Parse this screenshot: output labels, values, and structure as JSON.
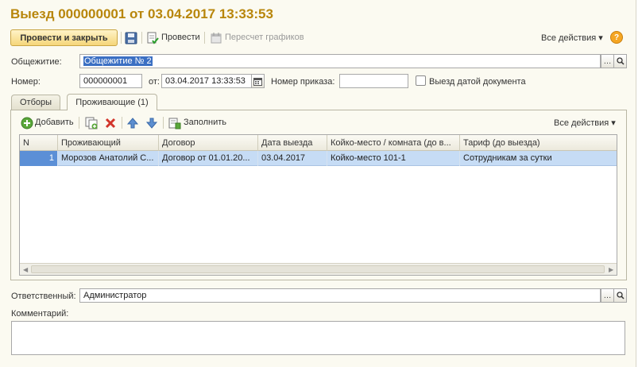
{
  "window": {
    "title": "Выезд 000000001 от 03.04.2017 13:33:53"
  },
  "toolbar": {
    "post_close_label": "Провести и закрыть",
    "post_label": "Провести",
    "recalc_label": "Пересчет графиков",
    "all_actions_label": "Все действия",
    "help_symbol": "?"
  },
  "form": {
    "dormitory_label": "Общежитие:",
    "dormitory_value": "Общежитие № 2",
    "number_label": "Номер:",
    "number_value": "000000001",
    "date_label": "от:",
    "date_value": "03.04.2017 13:33:53",
    "order_label": "Номер приказа:",
    "order_value": "",
    "checkout_by_doc_date_label": "Выезд датой документа",
    "checkout_by_doc_date_checked": false,
    "responsible_label": "Ответственный:",
    "responsible_value": "Администратор",
    "comment_label": "Комментарий:",
    "comment_value": ""
  },
  "tabs": [
    {
      "label": "Отборы",
      "active": false
    },
    {
      "label": "Проживающие (1)",
      "active": true
    }
  ],
  "grid_toolbar": {
    "add_label": "Добавить",
    "fill_label": "Заполнить",
    "all_actions_label": "Все действия"
  },
  "grid": {
    "columns": [
      "N",
      "Проживающий",
      "Договор",
      "Дата выезда",
      "Койко-место / комната (до в...",
      "Тариф (до выезда)"
    ],
    "rows": [
      [
        "1",
        "Морозов Анатолий С...",
        "Договор  от 01.01.20...",
        "03.04.2017",
        "Койко-место 101-1",
        "Сотрудникам за сутки"
      ]
    ]
  },
  "colors": {
    "title": "#b8860b",
    "selected_row": "#c6dcf5",
    "primary_button": "#f5d67a"
  }
}
